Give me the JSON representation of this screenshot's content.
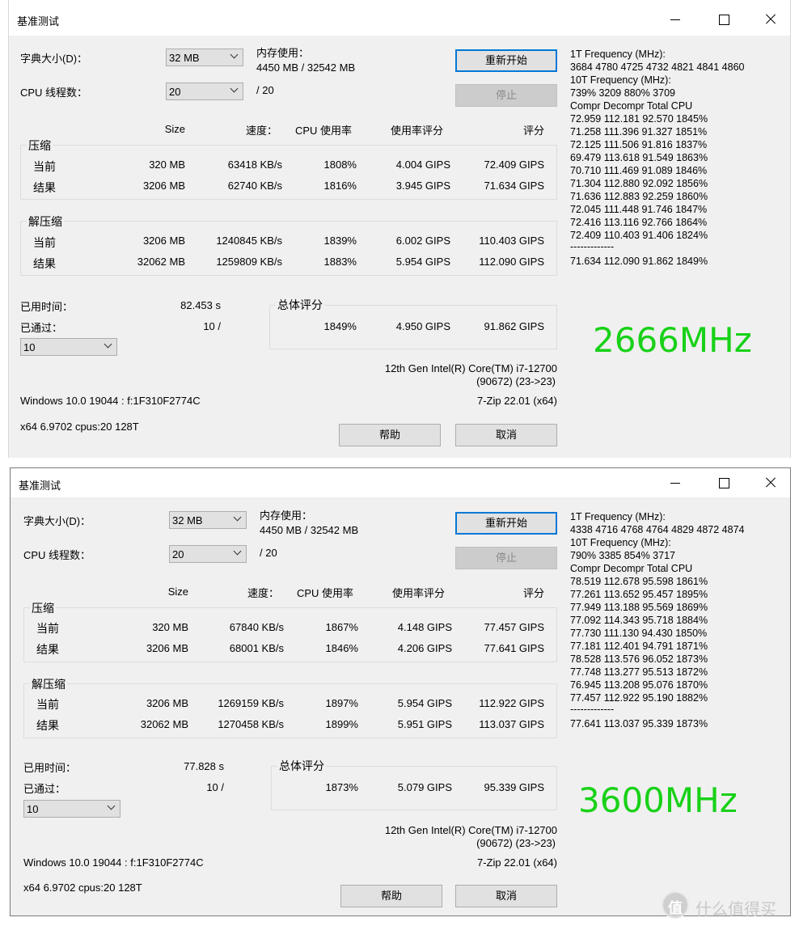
{
  "colors": {
    "freq_label": "#18d118",
    "default_button_border": "#0078d7"
  },
  "windows": [
    {
      "title": "基准测试",
      "dict_label": "字典大小(D)：",
      "dict_value": "32 MB",
      "threads_label": "CPU 线程数：",
      "threads_value": "20",
      "threads_max": "/ 20",
      "mem_label": "内存使用：",
      "mem_value": "4450 MB / 32542 MB",
      "restart": "重新开始",
      "stop": "停止",
      "headers": {
        "size": "Size",
        "speed": "速度：",
        "cpu": "CPU 使用率",
        "rating": "使用率评分",
        "score": "评分"
      },
      "compress": {
        "label": "压缩",
        "current": {
          "label": "当前",
          "size": "320 MB",
          "speed": "63418 KB/s",
          "cpu": "1808%",
          "rating": "4.004 GIPS",
          "score": "72.409 GIPS"
        },
        "result": {
          "label": "结果",
          "size": "3206 MB",
          "speed": "62740 KB/s",
          "cpu": "1816%",
          "rating": "3.945 GIPS",
          "score": "71.634 GIPS"
        }
      },
      "decompress": {
        "label": "解压缩",
        "current": {
          "label": "当前",
          "size": "3206 MB",
          "speed": "1240845 KB/s",
          "cpu": "1839%",
          "rating": "6.002 GIPS",
          "score": "110.403 GIPS"
        },
        "result": {
          "label": "结果",
          "size": "32062 MB",
          "speed": "1259809 KB/s",
          "cpu": "1883%",
          "rating": "5.954 GIPS",
          "score": "112.090 GIPS"
        }
      },
      "elapsed_label": "已用时间：",
      "elapsed_value": "82.453 s",
      "passed_label": "已通过：",
      "passed_value": "10 /",
      "passes_value": "10",
      "total_label": "总体评分",
      "total": {
        "cpu": "1849%",
        "rating": "4.950 GIPS",
        "score": "91.862 GIPS"
      },
      "cpu_name": "12th Gen Intel(R) Core(TM) i7-12700",
      "cpu_id": "(90672) (23->23)",
      "os": "Windows 10.0 19044 : f:1F310F2774C",
      "zip": "7-Zip 22.01 (x64)",
      "arch": "x64 6.9702 cpus:20 128T",
      "help": "帮助",
      "cancel": "取消",
      "side": [
        "1T Frequency (MHz):",
        " 3684 4780 4725 4732 4821 4841 4860",
        "10T Frequency (MHz):",
        " 739% 3209 880% 3709",
        "Compr Decompr Total   CPU",
        "72.959  112.181  92.570  1845%",
        "71.258  111.396  91.327  1851%",
        "72.125  111.506  91.816  1837%",
        "69.479  113.618  91.549  1863%",
        "70.710  111.469  91.089  1846%",
        "71.304  112.880  92.092  1856%",
        "71.636  112.883  92.259  1860%",
        "72.045  111.448  91.746  1847%",
        "72.416  113.116  92.766  1864%",
        "72.409  110.403  91.406  1824%",
        "-------------",
        "71.634  112.090  91.862  1849%"
      ],
      "freq_label": "2666MHz"
    },
    {
      "title": "基准测试",
      "dict_label": "字典大小(D)：",
      "dict_value": "32 MB",
      "threads_label": "CPU 线程数：",
      "threads_value": "20",
      "threads_max": "/ 20",
      "mem_label": "内存使用：",
      "mem_value": "4450 MB / 32542 MB",
      "restart": "重新开始",
      "stop": "停止",
      "headers": {
        "size": "Size",
        "speed": "速度：",
        "cpu": "CPU 使用率",
        "rating": "使用率评分",
        "score": "评分"
      },
      "compress": {
        "label": "压缩",
        "current": {
          "label": "当前",
          "size": "320 MB",
          "speed": "67840 KB/s",
          "cpu": "1867%",
          "rating": "4.148 GIPS",
          "score": "77.457 GIPS"
        },
        "result": {
          "label": "结果",
          "size": "3206 MB",
          "speed": "68001 KB/s",
          "cpu": "1846%",
          "rating": "4.206 GIPS",
          "score": "77.641 GIPS"
        }
      },
      "decompress": {
        "label": "解压缩",
        "current": {
          "label": "当前",
          "size": "3206 MB",
          "speed": "1269159 KB/s",
          "cpu": "1897%",
          "rating": "5.954 GIPS",
          "score": "112.922 GIPS"
        },
        "result": {
          "label": "结果",
          "size": "32062 MB",
          "speed": "1270458 KB/s",
          "cpu": "1899%",
          "rating": "5.951 GIPS",
          "score": "113.037 GIPS"
        }
      },
      "elapsed_label": "已用时间：",
      "elapsed_value": "77.828 s",
      "passed_label": "已通过：",
      "passed_value": "10 /",
      "passes_value": "10",
      "total_label": "总体评分",
      "total": {
        "cpu": "1873%",
        "rating": "5.079 GIPS",
        "score": "95.339 GIPS"
      },
      "cpu_name": "12th Gen Intel(R) Core(TM) i7-12700",
      "cpu_id": "(90672) (23->23)",
      "os": "Windows 10.0 19044 : f:1F310F2774C",
      "zip": "7-Zip 22.01 (x64)",
      "arch": "x64 6.9702 cpus:20 128T",
      "help": "帮助",
      "cancel": "取消",
      "side": [
        "1T Frequency (MHz):",
        " 4338 4716 4768 4764 4829 4872 4874",
        "10T Frequency (MHz):",
        " 790% 3385 854% 3717",
        "Compr Decompr Total   CPU",
        "78.519  112.678  95.598  1861%",
        "77.261  113.652  95.457  1895%",
        "77.949  113.188  95.569  1869%",
        "77.092  114.343  95.718  1884%",
        "77.730  111.130  94.430  1850%",
        "77.181  112.401  94.791  1871%",
        "78.528  113.576  96.052  1873%",
        "77.748  113.277  95.513  1872%",
        "76.945  113.208  95.076  1870%",
        "77.457  112.922  95.190  1882%",
        "-------------",
        "77.641  113.037  95.339  1873%"
      ],
      "freq_label": "3600MHz"
    }
  ],
  "watermark": {
    "text": "什么值得买"
  }
}
